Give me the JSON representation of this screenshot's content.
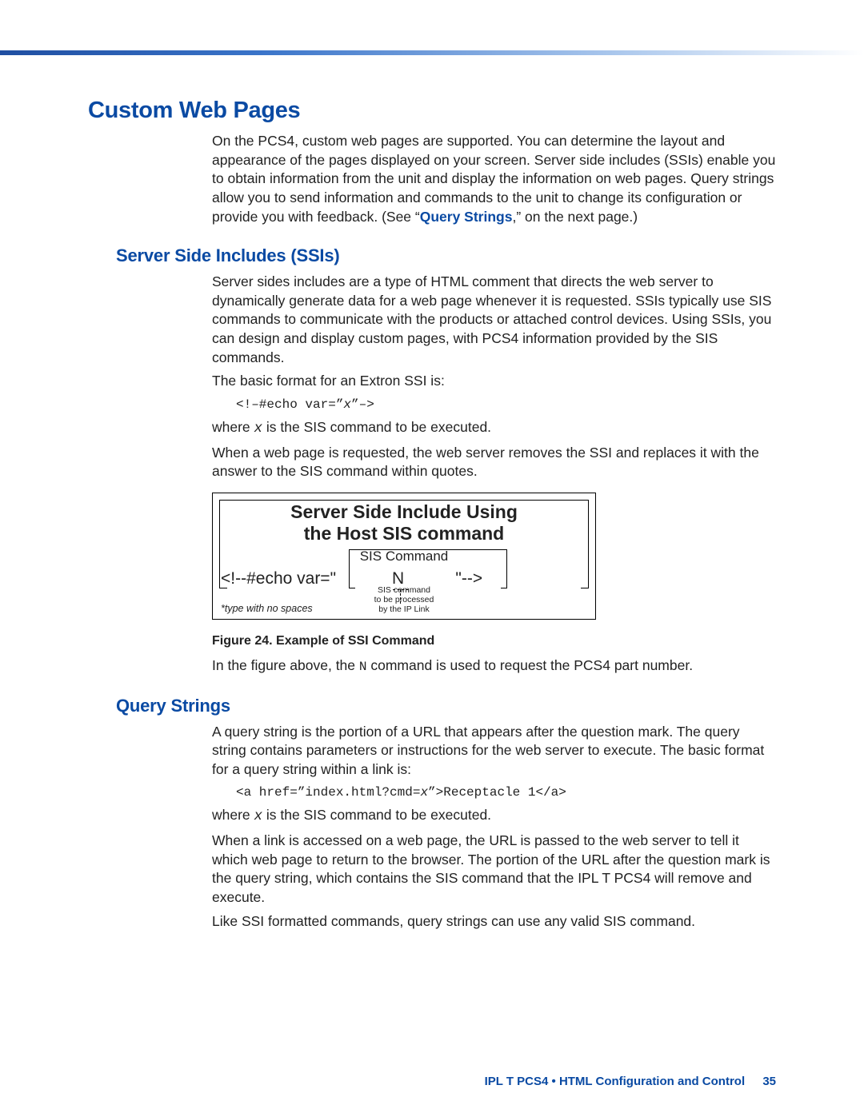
{
  "headings": {
    "h1": "Custom Web Pages",
    "h2_ssi": "Server Side Includes (SSIs)",
    "h2_qs": "Query Strings"
  },
  "intro": {
    "p1a": "On the PCS4, custom web pages are supported. You can determine the layout and appearance of the pages displayed on your screen. Server side includes (SSIs) enable you to obtain information from the unit and display the information on web pages. Query strings allow you to send information and commands to the unit to change its configuration or provide you with feedback. (See “",
    "link": "Query Strings",
    "p1b": ",” on the next page.)"
  },
  "ssi": {
    "p1": "Server sides includes are a type of HTML comment that directs the web server to dynamically generate data for a web page whenever it is requested. SSIs typically use SIS commands to communicate with the products or attached control devices. Using SSIs, you can design and display custom pages, with PCS4 information provided by the SIS commands.",
    "p2": "The basic format for an Extron SSI is:",
    "code1_pre": "<!–#echo var=”",
    "code1_var": "x",
    "code1_post": "”–>",
    "p3_pre": "where ",
    "p3_var": "x",
    "p3_post": " is the SIS command to be executed.",
    "p4": "When a web page is requested, the web server removes the SSI and replaces it with the answer to the SIS command within quotes.",
    "fig": {
      "title_l1": "Server Side Include Using",
      "title_l2": "the Host SIS command",
      "sis_label": "SIS Command",
      "cmd_left": "<!--#echo var=\"",
      "cmd_mid": "N",
      "cmd_right": "\"-->",
      "annot_l1": "SIS command",
      "annot_l2": "to be processed",
      "annot_l3": "by the IP Link",
      "footnote": "*type with no spaces"
    },
    "caption": "Figure 24. Example of SSI Command",
    "p5_pre": "In the figure above, the ",
    "p5_cmd": "N",
    "p5_post": " command is used to request the PCS4 part number."
  },
  "qs": {
    "p1": "A query string is the portion of a URL that appears after the question mark. The query string contains parameters or instructions for the web server to execute. The basic format for a query string within a link is:",
    "code_pre": "<a href=”index.html?cmd=",
    "code_var": "x",
    "code_post": "”>Receptacle 1</a>",
    "p2_pre": "where ",
    "p2_var": "x",
    "p2_post": " is the SIS command to be executed.",
    "p3": "When a link is accessed on a web page, the URL is passed to the web server to tell it which web page to return to the browser. The portion of the URL after the question mark is the query string, which contains the SIS command that the IPL T PCS4 will remove and execute.",
    "p4": "Like SSI formatted commands, query strings can use any valid SIS command."
  },
  "footer": {
    "text": "IPL T PCS4 • HTML Configuration and Control",
    "page": "35"
  }
}
